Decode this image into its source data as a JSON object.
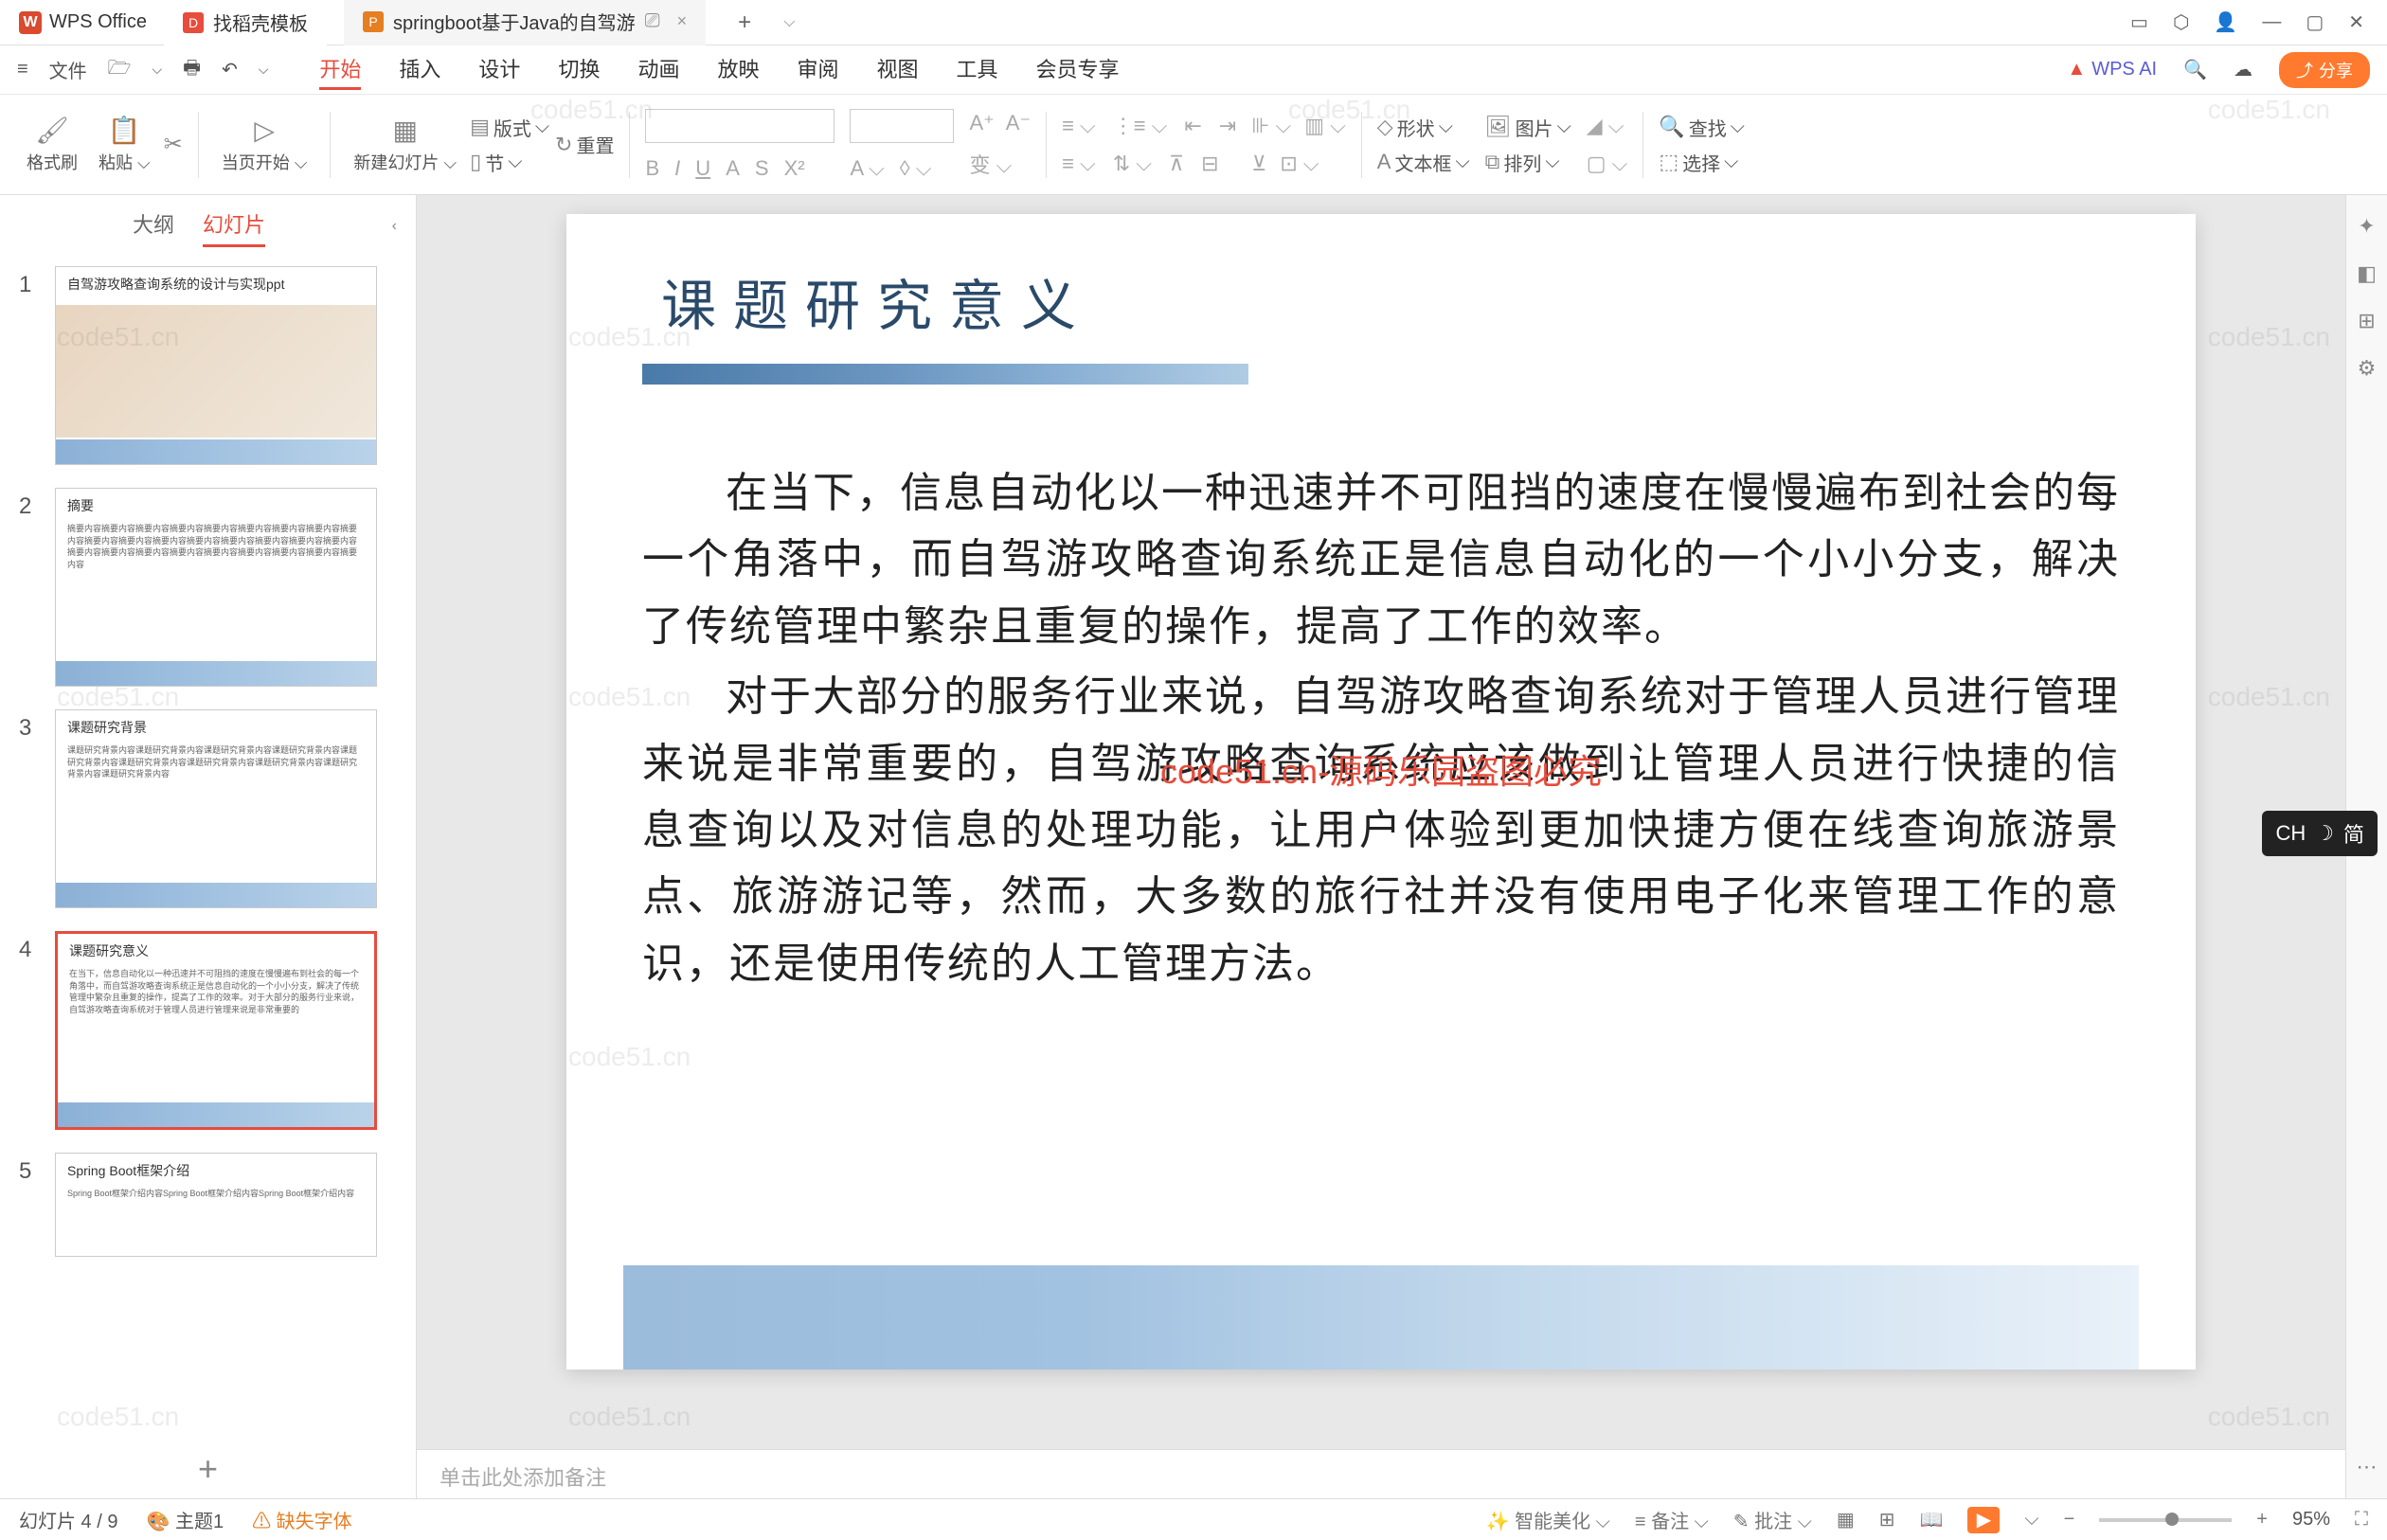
{
  "titlebar": {
    "app_name": "WPS Office",
    "tabs": [
      {
        "label": "找稻壳模板",
        "icon": "D"
      },
      {
        "label": "springboot基于Java的自驾游"
      }
    ],
    "close": "×",
    "window_controls": {
      "min": "—",
      "max": "▢",
      "close": "✕"
    }
  },
  "menubar": {
    "file": "文件",
    "tabs": [
      "开始",
      "插入",
      "设计",
      "切换",
      "动画",
      "放映",
      "审阅",
      "视图",
      "工具",
      "会员专享"
    ],
    "wps_ai": "WPS AI",
    "share": "分享"
  },
  "ribbon": {
    "format_painter": "格式刷",
    "paste": "粘贴",
    "from_current": "当页开始",
    "new_slide": "新建幻灯片",
    "layout": "版式",
    "section": "节",
    "reset": "重置",
    "shape": "形状",
    "picture": "图片",
    "textbox": "文本框",
    "arrange": "排列",
    "find": "查找",
    "select": "选择"
  },
  "sidebar": {
    "outline": "大纲",
    "slides": "幻灯片",
    "thumbs": [
      {
        "n": "1",
        "title": "自驾游攻略查询系统的设计与实现ppt"
      },
      {
        "n": "2",
        "title": "摘要"
      },
      {
        "n": "3",
        "title": "课题研究背景"
      },
      {
        "n": "4",
        "title": "课题研究意义"
      },
      {
        "n": "5",
        "title": "Spring Boot框架介绍"
      }
    ],
    "add": "+"
  },
  "slide": {
    "title": "课题研究意义",
    "para1": "在当下，信息自动化以一种迅速并不可阻挡的速度在慢慢遍布到社会的每一个角落中，而自驾游攻略查询系统正是信息自动化的一个小小分支，解决了传统管理中繁杂且重复的操作，提高了工作的效率。",
    "para2": "对于大部分的服务行业来说，自驾游攻略查询系统对于管理人员进行管理来说是非常重要的，自驾游攻略查询系统应该做到让管理人员进行快捷的信息查询以及对信息的处理功能，让用户体验到更加快捷方便在线查询旅游景点、旅游游记等，然而，大多数的旅行社并没有使用电子化来管理工作的意识，还是使用传统的人工管理方法。",
    "watermark": "code51.cn-源码乐园盗图必究"
  },
  "notes": {
    "placeholder": "单击此处添加备注"
  },
  "statusbar": {
    "slide_count": "幻灯片 4 / 9",
    "theme": "主题1",
    "missing_font": "缺失字体",
    "smart_beautify": "智能美化",
    "notes": "备注",
    "review": "批注",
    "zoom": "95%"
  },
  "ime": {
    "lang": "CH",
    "mode": "简"
  },
  "ghost": "code51.cn"
}
